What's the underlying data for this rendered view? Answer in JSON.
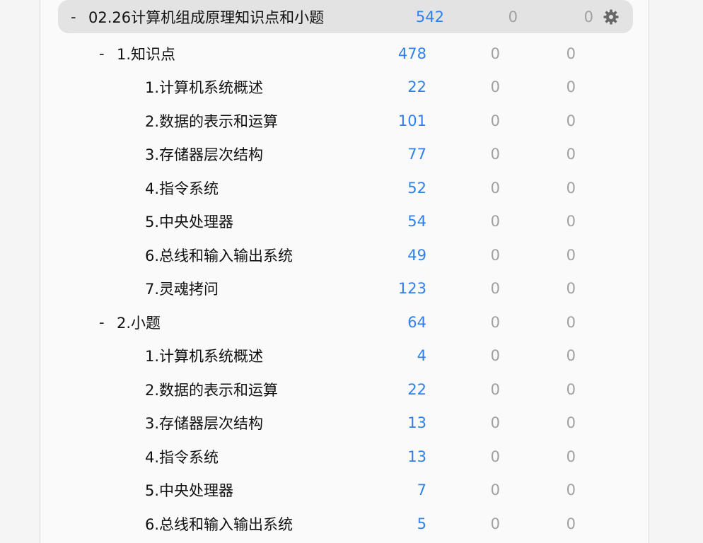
{
  "colors": {
    "new": "#2f80ed",
    "muted": "#a0a0a0",
    "highlight": "#e3e3e3"
  },
  "top_deck": {
    "collapse": "-",
    "name": "02.26计算机组成原理知识点和小题",
    "new": "542",
    "learn": "0",
    "due": "0",
    "options_icon": "gear-icon"
  },
  "decks": [
    {
      "level": 1,
      "collapse": "-",
      "name": "1.知识点",
      "new": "478",
      "learn": "0",
      "due": "0"
    },
    {
      "level": 2,
      "collapse": "",
      "name": "1.计算机系统概述",
      "new": "22",
      "learn": "0",
      "due": "0"
    },
    {
      "level": 2,
      "collapse": "",
      "name": "2.数据的表示和运算",
      "new": "101",
      "learn": "0",
      "due": "0"
    },
    {
      "level": 2,
      "collapse": "",
      "name": "3.存储器层次结构",
      "new": "77",
      "learn": "0",
      "due": "0"
    },
    {
      "level": 2,
      "collapse": "",
      "name": "4.指令系统",
      "new": "52",
      "learn": "0",
      "due": "0"
    },
    {
      "level": 2,
      "collapse": "",
      "name": "5.中央处理器",
      "new": "54",
      "learn": "0",
      "due": "0"
    },
    {
      "level": 2,
      "collapse": "",
      "name": "6.总线和输入输出系统",
      "new": "49",
      "learn": "0",
      "due": "0"
    },
    {
      "level": 2,
      "collapse": "",
      "name": "7.灵魂拷问",
      "new": "123",
      "learn": "0",
      "due": "0"
    },
    {
      "level": 1,
      "collapse": "-",
      "name": "2.小题",
      "new": "64",
      "learn": "0",
      "due": "0"
    },
    {
      "level": 2,
      "collapse": "",
      "name": "1.计算机系统概述",
      "new": "4",
      "learn": "0",
      "due": "0"
    },
    {
      "level": 2,
      "collapse": "",
      "name": "2.数据的表示和运算",
      "new": "22",
      "learn": "0",
      "due": "0"
    },
    {
      "level": 2,
      "collapse": "",
      "name": "3.存储器层次结构",
      "new": "13",
      "learn": "0",
      "due": "0"
    },
    {
      "level": 2,
      "collapse": "",
      "name": "4.指令系统",
      "new": "13",
      "learn": "0",
      "due": "0"
    },
    {
      "level": 2,
      "collapse": "",
      "name": "5.中央处理器",
      "new": "7",
      "learn": "0",
      "due": "0"
    },
    {
      "level": 2,
      "collapse": "",
      "name": "6.总线和输入输出系统",
      "new": "5",
      "learn": "0",
      "due": "0"
    }
  ]
}
